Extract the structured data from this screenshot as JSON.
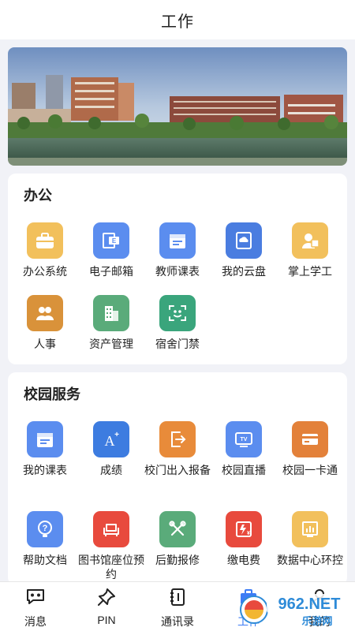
{
  "header": {
    "title": "工作"
  },
  "office": {
    "title": "办公",
    "items": [
      {
        "label": "办公系统",
        "icon": "briefcase-icon",
        "color": "#f2c05c"
      },
      {
        "label": "电子邮箱",
        "icon": "mail-icon",
        "color": "#5b8def"
      },
      {
        "label": "教师课表",
        "icon": "schedule-icon",
        "color": "#5b8def"
      },
      {
        "label": "我的云盘",
        "icon": "cloud-disk-icon",
        "color": "#4a7de0"
      },
      {
        "label": "掌上学工",
        "icon": "student-icon",
        "color": "#f2c05c"
      },
      {
        "label": "人事",
        "icon": "people-icon",
        "color": "#d9923a"
      },
      {
        "label": "资产管理",
        "icon": "building-icon",
        "color": "#5aab7a"
      },
      {
        "label": "宿舍门禁",
        "icon": "face-scan-icon",
        "color": "#3aa57c"
      }
    ]
  },
  "campus": {
    "title": "校园服务",
    "items": [
      {
        "label": "我的课表",
        "icon": "schedule-icon",
        "color": "#5b8def"
      },
      {
        "label": "成绩",
        "icon": "grade-icon",
        "color": "#3d7ce0"
      },
      {
        "label": "校门出入报备",
        "icon": "gate-report-icon",
        "color": "#e88b3a"
      },
      {
        "label": "校园直播",
        "icon": "tv-icon",
        "color": "#5b8def"
      },
      {
        "label": "校园一卡通",
        "icon": "card-icon",
        "color": "#e3813a"
      },
      {
        "label": "帮助文档",
        "icon": "help-icon",
        "color": "#5b8def"
      },
      {
        "label": "图书馆座位预约",
        "icon": "seat-icon",
        "color": "#e84a3d"
      },
      {
        "label": "后勤报修",
        "icon": "repair-icon",
        "color": "#5aab7a"
      },
      {
        "label": "缴电费",
        "icon": "electric-bill-icon",
        "color": "#e84a3d"
      },
      {
        "label": "数据中心环控",
        "icon": "data-center-icon",
        "color": "#f2c05c"
      }
    ]
  },
  "nav": {
    "items": [
      {
        "label": "消息",
        "icon": "message-icon"
      },
      {
        "label": "PIN",
        "icon": "pin-icon"
      },
      {
        "label": "通讯录",
        "icon": "contacts-icon"
      },
      {
        "label": "工作",
        "icon": "work-icon",
        "active": true
      },
      {
        "label": "我的",
        "icon": "profile-icon"
      }
    ]
  },
  "watermark": {
    "text": "962.NET",
    "subtext": "乐游网"
  },
  "colors": {
    "accent": "#3d7cf5",
    "background": "#f1f2f7"
  }
}
